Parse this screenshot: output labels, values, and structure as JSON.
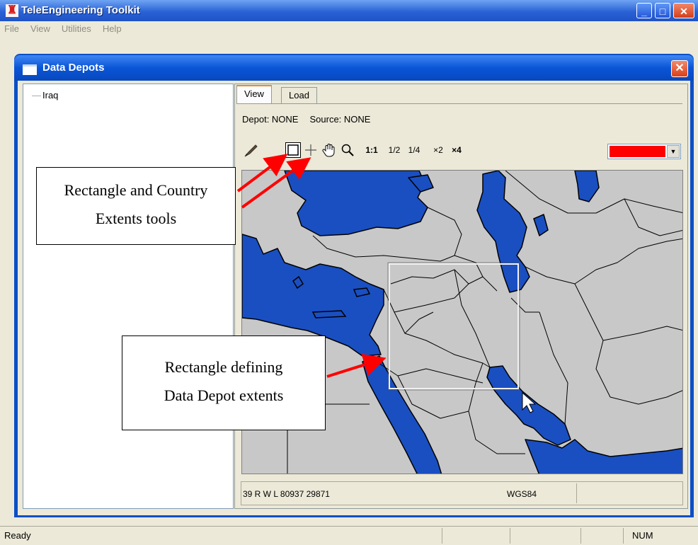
{
  "app": {
    "title": "TeleEngineering Toolkit",
    "icon": "app-logo-icon"
  },
  "menu": [
    "File",
    "View",
    "Utilities",
    "Help"
  ],
  "dialog": {
    "title": "Data Depots",
    "tree": {
      "items": [
        "Iraq"
      ]
    },
    "tabs": [
      {
        "label": "View"
      },
      {
        "label": "Load"
      }
    ],
    "info": {
      "depot": "Depot: NONE",
      "source": "Source: NONE"
    },
    "toolbar": {
      "tools": [
        {
          "name": "draw-tool",
          "icon": "pen-icon"
        },
        {
          "name": "rectangle-tool",
          "icon": "rectangle-icon",
          "selected": true
        },
        {
          "name": "country-extents-tool",
          "icon": "crosshair-icon"
        },
        {
          "name": "pan-tool",
          "icon": "hand-icon"
        },
        {
          "name": "zoom-tool",
          "icon": "magnifier-icon"
        }
      ],
      "scale_labels": [
        "1:1",
        "1/2",
        "1/4",
        "×2",
        "×4"
      ],
      "color": "#ff0000"
    },
    "coords": {
      "position": "39 R W L 80937 29871",
      "datum": "WGS84"
    }
  },
  "status": {
    "text": "Ready",
    "num": "NUM"
  },
  "callouts": {
    "tools": {
      "line1": "Rectangle and Country",
      "line2": "Extents tools"
    },
    "rect": {
      "line1": "Rectangle defining",
      "line2": "Data Depot extents"
    }
  },
  "colors": {
    "water": "#1a4fc2",
    "land": "#c8c8c8",
    "titlebar": "#0a55d7",
    "annotation_arrow": "#ff0000"
  }
}
